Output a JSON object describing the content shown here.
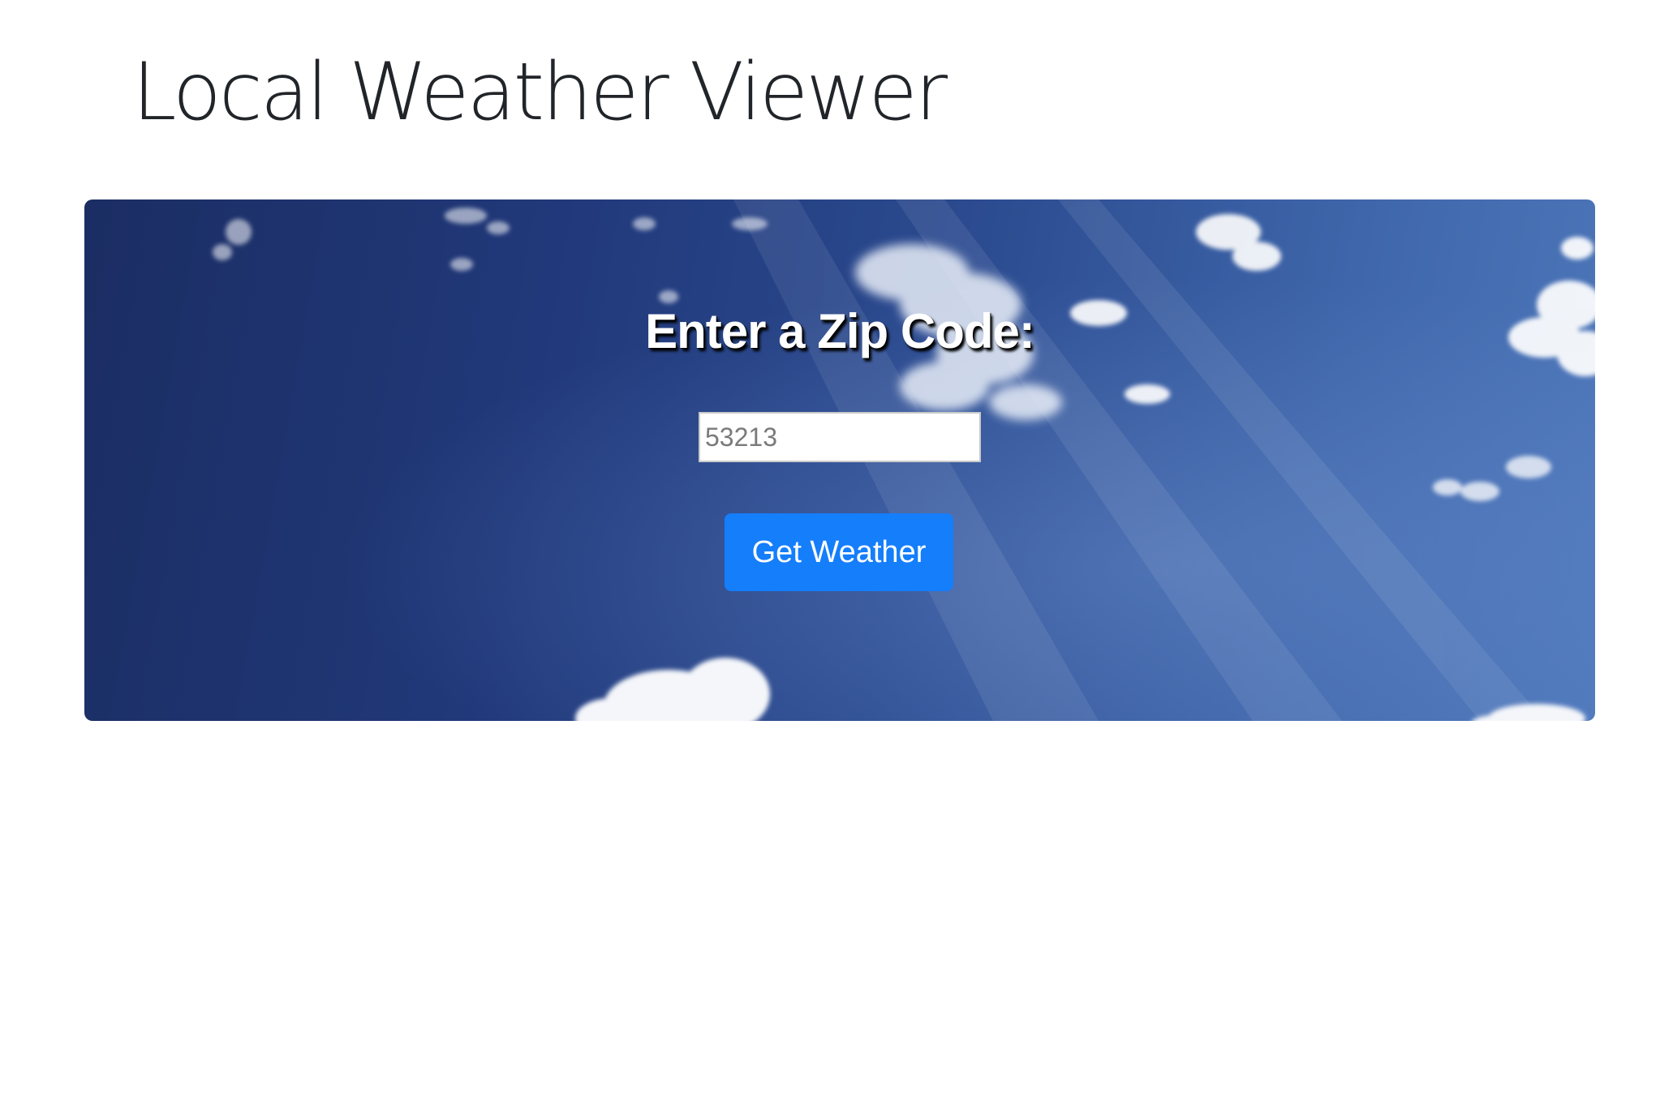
{
  "page": {
    "title": "Local Weather Viewer"
  },
  "hero": {
    "prompt": "Enter a Zip Code:",
    "zip_input": {
      "value": "",
      "placeholder": "53213"
    },
    "submit_label": "Get Weather"
  },
  "colors": {
    "button_bg": "#157efb",
    "sky_dark": "#1b2d63",
    "sky_light": "#4e78bb",
    "title_text": "#212529"
  }
}
